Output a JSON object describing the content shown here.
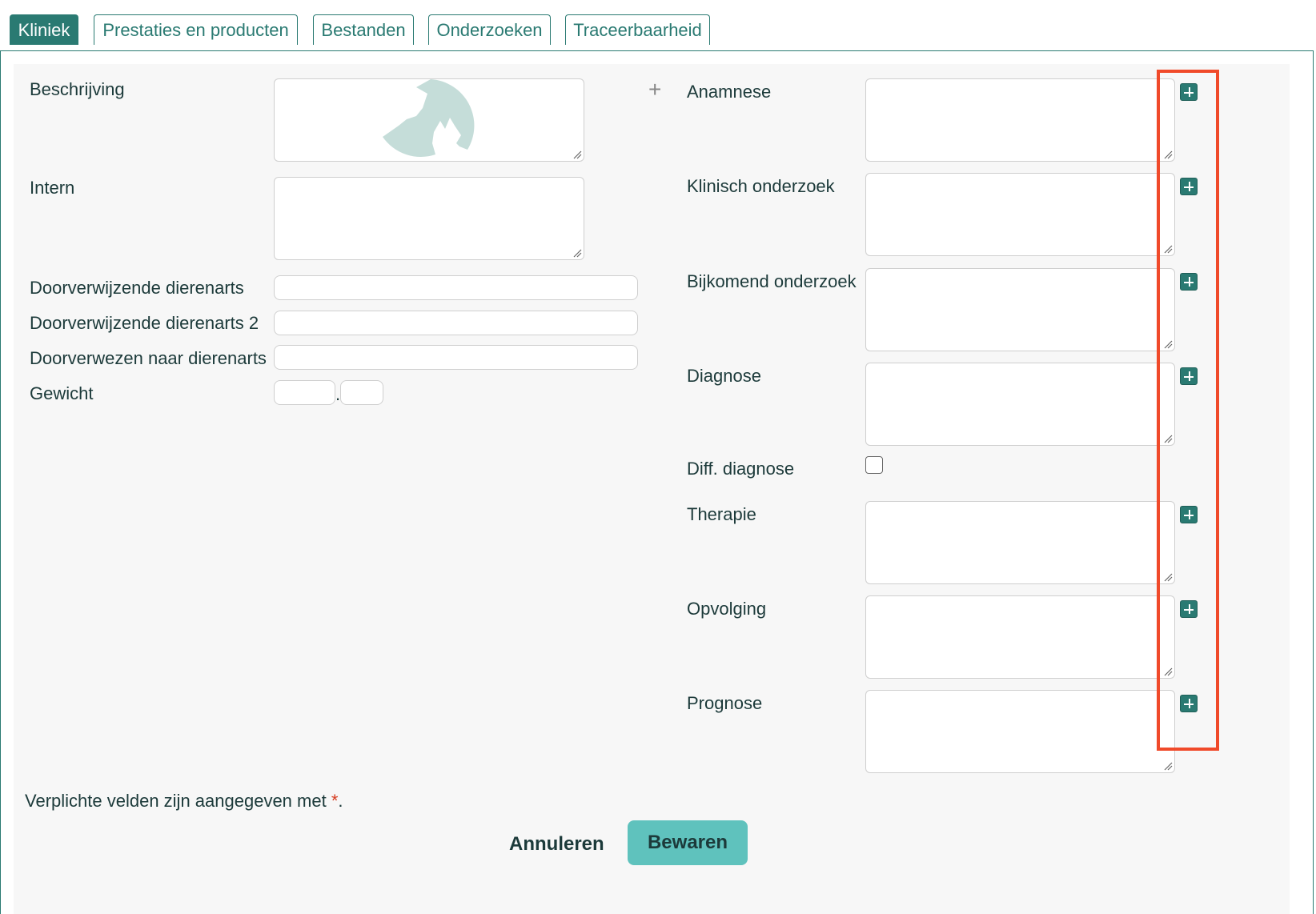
{
  "tabs": [
    {
      "label": "Kliniek",
      "active": true
    },
    {
      "label": "Prestaties en producten"
    },
    {
      "label": "Bestanden"
    },
    {
      "label": "Onderzoeken"
    },
    {
      "label": "Traceerbaarheid"
    }
  ],
  "left": {
    "beschrijving": "Beschrijving",
    "intern": "Intern",
    "doorverwijzende": "Doorverwijzende dierenarts",
    "doorverwijzende2": "Doorverwijzende dierenarts 2",
    "doorverwezen": "Doorverwezen naar dierenarts",
    "gewicht": "Gewicht",
    "gewicht_sep": "."
  },
  "right": {
    "anamnese": "Anamnese",
    "klinisch": "Klinisch onderzoek",
    "bijkomend": "Bijkomend onderzoek",
    "diagnose": "Diagnose",
    "diff": "Diff. diagnose",
    "therapie": "Therapie",
    "opvolging": "Opvolging",
    "prognose": "Prognose"
  },
  "footer": {
    "note": "Verplichte velden zijn aangegeven met ",
    "asterisk": "*",
    "period": ".",
    "cancel": "Annuleren",
    "save": "Bewaren"
  },
  "colors": {
    "accent": "#2a7a72",
    "save_button": "#5fc2bd",
    "highlight": "#f04a2a"
  }
}
